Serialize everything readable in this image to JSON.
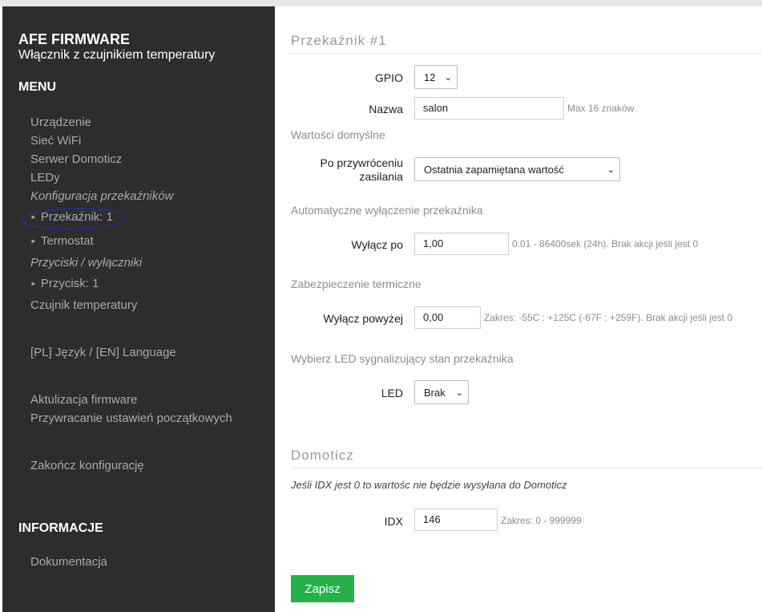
{
  "sidebar": {
    "title": "AFE FIRMWARE",
    "subtitle": "Włącznik z czujnikiem temperatury",
    "menu_heading": "MENU",
    "items": {
      "device": "Urządzenie",
      "wifi": "Sieć WiFi",
      "domoticz_server": "Serwer Domoticz",
      "leds": "LEDy",
      "relays_config": "Konfiguracja przekaźników",
      "relay1": "Przekaźnik: 1",
      "thermostat": "Termostat",
      "buttons_config": "Przyciski / wyłączniki",
      "button1": "Przycisk: 1",
      "temp_sensor": "Czujnik temperatury",
      "language": "[PL] Język / [EN] Language",
      "firmware_update": "Aktulizacja firmware",
      "factory_reset": "Przywracanie ustawień początkowych",
      "finish_config": "Zakończ konfigurację",
      "documentation": "Dokumentacja"
    },
    "info_heading": "INFORMACJE"
  },
  "relay": {
    "title": "Przekaźnik #1",
    "gpio_label": "GPIO",
    "gpio_value": "12",
    "name_label": "Nazwa",
    "name_value": "salon",
    "name_hint": "Max 16 znaków",
    "defaults_heading": "Wartości domyślne",
    "restore_label_1": "Po przywróceniu",
    "restore_label_2": "zasilania",
    "restore_value": "Ostatnia zapamiętana wartość",
    "auto_off_heading": "Automatyczne wyłączenie przekaźnika",
    "off_after_label": "Wyłącz po",
    "off_after_value": "1,00",
    "off_after_hint": "0.01 - 86400sek (24h). Brak akcji jeśli jest 0",
    "thermal_heading": "Zabezpieczenie termiczne",
    "off_above_label": "Wyłącz powyżej",
    "off_above_value": "0,00",
    "off_above_hint": "Zakres: -55C : +125C (-67F : +259F). Brak akcji jeśli jest 0",
    "led_heading": "Wybierz LED sygnalizujący stan przekaźnika",
    "led_label": "LED",
    "led_value": "Brak"
  },
  "domoticz": {
    "title": "Domoticz",
    "note": "Jeśli IDX jest 0 to wartośc nie będzie wysyłana do Domoticz",
    "idx_label": "IDX",
    "idx_value": "146",
    "idx_hint": "Zakres: 0 - 999999"
  },
  "save_label": "Zapisz",
  "colors": {
    "sidebar_bg": "#2d2d2d",
    "save_green": "#27b14d",
    "annotation_blue": "#1a2bd9"
  }
}
